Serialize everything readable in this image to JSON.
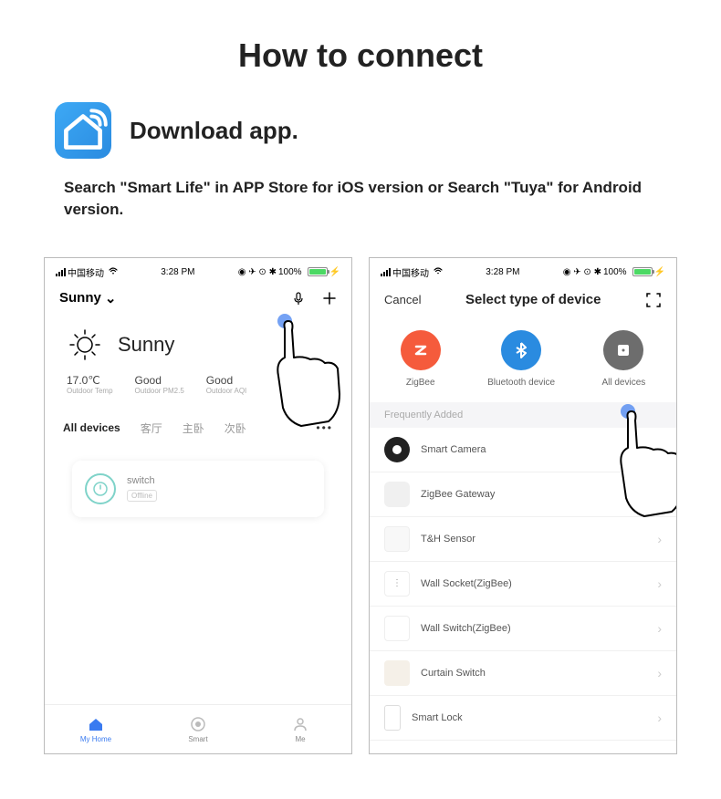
{
  "page": {
    "title": "How to connect",
    "download_heading": "Download  app.",
    "instruction": "Search \"Smart Life\" in APP Store for iOS version or Search \"Tuya\" for Android version."
  },
  "status": {
    "carrier": "中国移动",
    "time": "3:28 PM",
    "battery_pct": "100%"
  },
  "phone1": {
    "dropdown_label": "Sunny",
    "weather_label": "Sunny",
    "stats": [
      {
        "value": "17.0℃",
        "label": "Outdoor Temp"
      },
      {
        "value": "Good",
        "label": "Outdoor PM2.5"
      },
      {
        "value": "Good",
        "label": "Outdoor AQI"
      }
    ],
    "tabs": [
      "All devices",
      "客厅",
      "主卧",
      "次卧"
    ],
    "device": {
      "name": "switch",
      "status": "Offline"
    },
    "nav": [
      "My Home",
      "Smart",
      "Me"
    ]
  },
  "phone2": {
    "cancel": "Cancel",
    "title": "Select type of device",
    "types": [
      {
        "label": "ZigBee"
      },
      {
        "label": "Bluetooth device"
      },
      {
        "label": "All devices"
      }
    ],
    "freq_title": "Frequently Added",
    "list": [
      "Smart Camera",
      "ZigBee Gateway",
      "T&H Sensor",
      "Wall Socket(ZigBee)",
      "Wall Switch(ZigBee)",
      "Curtain Switch",
      "Smart Lock"
    ]
  }
}
